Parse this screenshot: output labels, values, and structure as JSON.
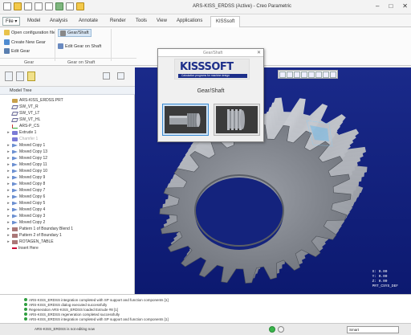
{
  "window": {
    "title": "ARS-KISS_ERDSS (Active) - Creo Parametric"
  },
  "menu": {
    "file": "File ▾",
    "tabs": [
      "Model",
      "Analysis",
      "Annotate",
      "Render",
      "Tools",
      "View",
      "Applications",
      "KISSsoft"
    ],
    "active_tab": "KISSsoft"
  },
  "ribbon": {
    "open_configuration": "Open configuration file",
    "gear_shaft": "Gear/Shaft",
    "create_new_gear": "Create New Gear",
    "edit_gear": "Edit Gear",
    "edit_gear_on_shaft": "Edit Gear on Shaft",
    "group_gear": "Gear",
    "group_gear_on_shaft": "Gear on Shaft"
  },
  "model_tree": {
    "header": "Model Tree",
    "items": [
      {
        "label": "ARS-KISS_ERDSS.PRT",
        "icon": "part-icon",
        "arrow": "",
        "muted": false
      },
      {
        "label": "SW_VT_R",
        "icon": "plane-icon",
        "arrow": "",
        "muted": false
      },
      {
        "label": "SW_VT_LT",
        "icon": "plane-icon",
        "arrow": "",
        "muted": false
      },
      {
        "label": "SW_VT_HL",
        "icon": "plane-icon",
        "arrow": "",
        "muted": false
      },
      {
        "label": "ARS-P_CS",
        "icon": "csys-icon",
        "arrow": "",
        "muted": false
      },
      {
        "label": "Extrude 1",
        "icon": "feature-icon",
        "arrow": "▸",
        "muted": false
      },
      {
        "label": "Chamfer 1",
        "icon": "feature-icon",
        "arrow": "",
        "muted": true
      },
      {
        "label": "Moved Copy 1",
        "icon": "copy-icon",
        "arrow": "▸",
        "muted": false
      },
      {
        "label": "Moved Copy 13",
        "icon": "copy-icon",
        "arrow": "▸",
        "muted": false
      },
      {
        "label": "Moved Copy 12",
        "icon": "copy-icon",
        "arrow": "▸",
        "muted": false
      },
      {
        "label": "Moved Copy 11",
        "icon": "copy-icon",
        "arrow": "▸",
        "muted": false
      },
      {
        "label": "Moved Copy 10",
        "icon": "copy-icon",
        "arrow": "▸",
        "muted": false
      },
      {
        "label": "Moved Copy 9",
        "icon": "copy-icon",
        "arrow": "▸",
        "muted": false
      },
      {
        "label": "Moved Copy 8",
        "icon": "copy-icon",
        "arrow": "▸",
        "muted": false
      },
      {
        "label": "Moved Copy 7",
        "icon": "copy-icon",
        "arrow": "▸",
        "muted": false
      },
      {
        "label": "Moved Copy 6",
        "icon": "copy-icon",
        "arrow": "▸",
        "muted": false
      },
      {
        "label": "Moved Copy 5",
        "icon": "copy-icon",
        "arrow": "▸",
        "muted": false
      },
      {
        "label": "Moved Copy 4",
        "icon": "copy-icon",
        "arrow": "▸",
        "muted": false
      },
      {
        "label": "Moved Copy 3",
        "icon": "copy-icon",
        "arrow": "▸",
        "muted": false
      },
      {
        "label": "Moved Copy 2",
        "icon": "copy-icon",
        "arrow": "▸",
        "muted": false
      },
      {
        "label": "Pattern 1 of Boundary Blend 1",
        "icon": "pattern-icon",
        "arrow": "▸",
        "muted": false
      },
      {
        "label": "Pattern 2 of Boundary 1",
        "icon": "pattern-icon",
        "arrow": "▸",
        "muted": false
      },
      {
        "label": "ROTAGEN_TABLE",
        "icon": "pattern-icon",
        "arrow": "▸",
        "muted": false
      },
      {
        "label": "Insert Here",
        "icon": "insert-icon",
        "arrow": "",
        "muted": false
      }
    ]
  },
  "dialog": {
    "title": "Gear/Shaft",
    "logo_word": "KISSSOFT",
    "logo_tagline": "Calculation programs for machine design",
    "label": "Gear/Shaft"
  },
  "messages": [
    "ARS-KISS_ERDSS integration completed with SP support and function components [1]",
    "ARS-KISS_ERDSS dialog executed successfully",
    "Regeneration ARS-KISS_ERDSS loaded Extrude #8 [1]",
    "ARS-KISS_ERDSS regeneration completed successfully",
    "ARS-KISS_ERDSS integration completed with SP support and function components [1]"
  ],
  "status": {
    "text": "ARS-KISS_ERDSS is not editing now",
    "selection_filter": "Smart"
  },
  "graphics": {
    "csys_readout": [
      "X: 0.00",
      "Y: 0.00",
      "Z: 0.00",
      "PRT_CSYS_DEF"
    ]
  },
  "colors": {
    "graphics_bg": "#14237d",
    "kiss_blue": "#1d2f8a"
  }
}
